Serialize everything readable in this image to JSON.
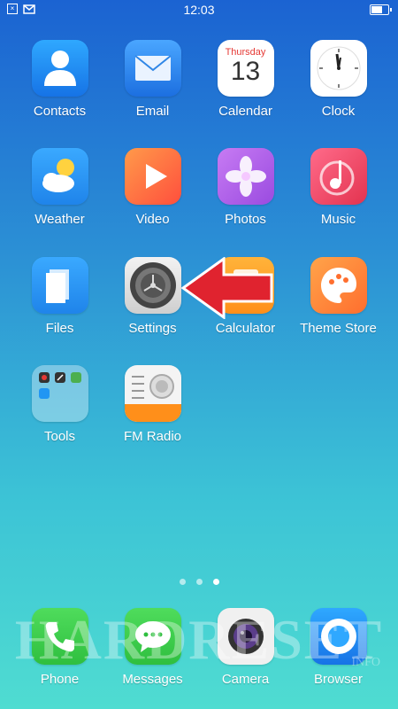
{
  "status_bar": {
    "time": "12:03",
    "battery_level": 0.6
  },
  "calendar": {
    "weekday": "Thursday",
    "day": "13"
  },
  "apps": [
    {
      "id": "contacts",
      "label": "Contacts"
    },
    {
      "id": "email",
      "label": "Email"
    },
    {
      "id": "calendar",
      "label": "Calendar"
    },
    {
      "id": "clock",
      "label": "Clock"
    },
    {
      "id": "weather",
      "label": "Weather"
    },
    {
      "id": "video",
      "label": "Video"
    },
    {
      "id": "photos",
      "label": "Photos"
    },
    {
      "id": "music",
      "label": "Music"
    },
    {
      "id": "files",
      "label": "Files"
    },
    {
      "id": "settings",
      "label": "Settings"
    },
    {
      "id": "calculator",
      "label": "Calculator"
    },
    {
      "id": "theme-store",
      "label": "Theme Store"
    },
    {
      "id": "tools",
      "label": "Tools"
    },
    {
      "id": "fm-radio",
      "label": "FM Radio"
    }
  ],
  "dock": [
    {
      "id": "phone",
      "label": "Phone"
    },
    {
      "id": "messages",
      "label": "Messages"
    },
    {
      "id": "camera",
      "label": "Camera"
    },
    {
      "id": "browser",
      "label": "Browser"
    }
  ],
  "page_indicator": {
    "count": 3,
    "active": 3
  },
  "watermark": {
    "text": "HARDRESET",
    "sub": "INFO"
  },
  "colors": {
    "contacts": "#1e90ff",
    "email": "#2f86e6",
    "weather": "#2a9df4",
    "video": "#ff7a3d",
    "photos": "#b766e8",
    "music": "#f24e6d",
    "files": "#2aa0f5",
    "settings": "#d9d9d9",
    "calculator": "#ffa31a",
    "theme_store": "#ff8a3a",
    "phone": "#3ccf4e",
    "messages": "#3ccf4e",
    "browser": "#1e8fe0",
    "arrow": "#e0232f"
  }
}
